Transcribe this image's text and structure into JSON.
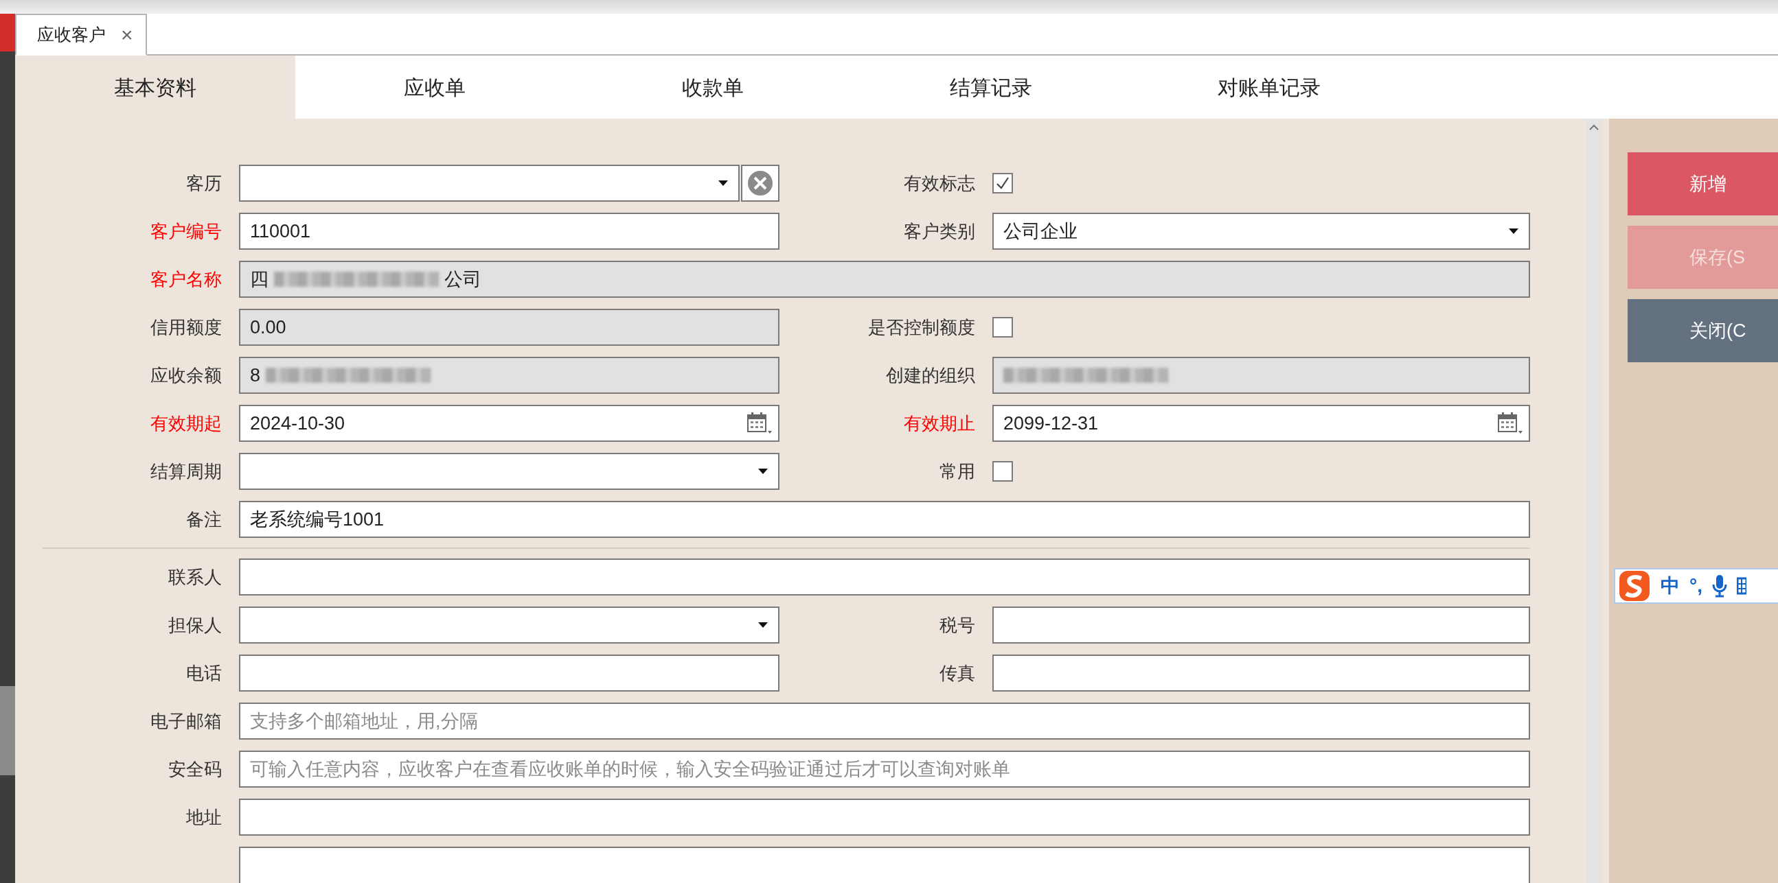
{
  "document_tabs": [
    {
      "label": "应收客户",
      "close": "×",
      "selected": true
    }
  ],
  "tabs": [
    {
      "label": "基本资料",
      "selected": true
    },
    {
      "label": "应收单",
      "selected": false
    },
    {
      "label": "收款单",
      "selected": false
    },
    {
      "label": "结算记录",
      "selected": false
    },
    {
      "label": "对账单记录",
      "selected": false
    }
  ],
  "form": {
    "sections": [
      {
        "rows": [
          {
            "fields": [
              {
                "label": "客历",
                "required": false,
                "kind": "select",
                "readonly": false,
                "clearable": true
              },
              {
                "label": "有效标志",
                "required": false,
                "kind": "checkbox",
                "checked": true
              }
            ]
          },
          {
            "fields": [
              {
                "label": "客户编号",
                "required": true,
                "kind": "text",
                "readonly": false,
                "value": "110001"
              },
              {
                "label": "客户类别",
                "required": false,
                "kind": "select",
                "readonly": false,
                "value": "公司企业"
              }
            ]
          },
          {
            "fields": [
              {
                "label": "客户名称",
                "required": true,
                "kind": "text",
                "readonly": true,
                "full": true,
                "segments": [
                  {
                    "kind": "text",
                    "text": "四"
                  },
                  {
                    "kind": "redacted"
                  },
                  {
                    "kind": "text",
                    "text": "公司"
                  }
                ]
              }
            ]
          },
          {
            "fields": [
              {
                "label": "信用额度",
                "required": false,
                "kind": "text",
                "readonly": true,
                "value": "0.00"
              },
              {
                "label": "是否控制额度",
                "required": false,
                "kind": "checkbox",
                "checked": false
              }
            ]
          },
          {
            "fields": [
              {
                "label": "应收余额",
                "required": false,
                "kind": "text",
                "readonly": true,
                "segments": [
                  {
                    "kind": "text",
                    "text": "8"
                  },
                  {
                    "kind": "redacted"
                  }
                ]
              },
              {
                "label": "创建的组织",
                "required": false,
                "kind": "text",
                "readonly": true,
                "segments": [
                  {
                    "kind": "redacted"
                  }
                ]
              }
            ]
          },
          {
            "fields": [
              {
                "label": "有效期起",
                "required": true,
                "kind": "date",
                "readonly": false,
                "value": "2024-10-30"
              },
              {
                "label": "有效期止",
                "required": true,
                "kind": "date",
                "readonly": false,
                "value": "2099-12-31"
              }
            ]
          },
          {
            "fields": [
              {
                "label": "结算周期",
                "required": false,
                "kind": "select",
                "readonly": false
              },
              {
                "label": "常用",
                "required": false,
                "kind": "checkbox",
                "checked": false
              }
            ]
          },
          {
            "fields": [
              {
                "label": "备注",
                "required": false,
                "kind": "text",
                "readonly": false,
                "full": true,
                "value": "老系统编号1001"
              }
            ]
          }
        ]
      },
      {
        "rows": [
          {
            "fields": [
              {
                "label": "联系人",
                "required": false,
                "kind": "text",
                "readonly": false,
                "full": true
              }
            ]
          },
          {
            "fields": [
              {
                "label": "担保人",
                "required": false,
                "kind": "select",
                "readonly": false
              },
              {
                "label": "税号",
                "required": false,
                "kind": "text",
                "readonly": false
              }
            ]
          },
          {
            "fields": [
              {
                "label": "电话",
                "required": false,
                "kind": "text",
                "readonly": false
              },
              {
                "label": "传真",
                "required": false,
                "kind": "text",
                "readonly": false
              }
            ]
          },
          {
            "fields": [
              {
                "label": "电子邮箱",
                "required": false,
                "kind": "text",
                "readonly": false,
                "full": true,
                "placeholder": "支持多个邮箱地址，用,分隔"
              }
            ]
          },
          {
            "fields": [
              {
                "label": "安全码",
                "required": false,
                "kind": "text",
                "readonly": false,
                "full": true,
                "placeholder": "可输入任意内容，应收客户在查看应收账单的时候，输入安全码验证通过后才可以查询对账单"
              }
            ]
          },
          {
            "fields": [
              {
                "label": "地址",
                "required": false,
                "kind": "text",
                "readonly": false,
                "full": true
              }
            ]
          },
          {
            "fields": [
              {
                "kind": "textarea",
                "readonly": false,
                "full": true
              }
            ]
          }
        ]
      }
    ]
  },
  "actions": [
    {
      "label": "新增",
      "kind": "primary",
      "disabled": false
    },
    {
      "label": "保存(S",
      "kind": "primary",
      "disabled": true
    },
    {
      "label": "关闭(C",
      "kind": "secondary",
      "disabled": false
    }
  ],
  "ime_toolbar": {
    "mode": "中",
    "punctuation": "°,"
  }
}
